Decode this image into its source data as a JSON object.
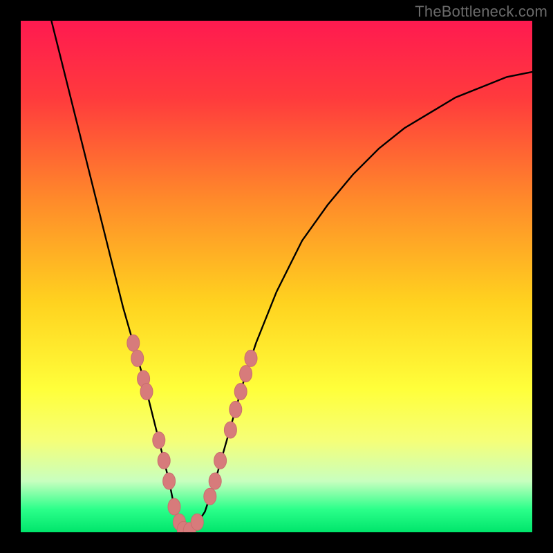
{
  "watermark": "TheBottleneck.com",
  "colors": {
    "frame": "#000000",
    "curve": "#000000",
    "marker_fill": "#d77b7b",
    "marker_stroke": "#c96e6e",
    "gradient_stops": [
      {
        "offset": 0.0,
        "color": "#ff1a50"
      },
      {
        "offset": 0.15,
        "color": "#ff3a3d"
      },
      {
        "offset": 0.35,
        "color": "#ff8a2a"
      },
      {
        "offset": 0.55,
        "color": "#ffd21f"
      },
      {
        "offset": 0.72,
        "color": "#ffff3a"
      },
      {
        "offset": 0.82,
        "color": "#f6ff77"
      },
      {
        "offset": 0.9,
        "color": "#c8ffbf"
      },
      {
        "offset": 0.955,
        "color": "#2bff8a"
      },
      {
        "offset": 1.0,
        "color": "#00e56b"
      }
    ]
  },
  "chart_data": {
    "type": "line",
    "title": "",
    "xlabel": "",
    "ylabel": "",
    "xlim": [
      0,
      100
    ],
    "ylim": [
      0,
      100
    ],
    "grid": false,
    "legend": false,
    "series": [
      {
        "name": "curve",
        "x": [
          6,
          8,
          10,
          12,
          14,
          16,
          18,
          20,
          22,
          24,
          26,
          27,
          28,
          29,
          30,
          31,
          32,
          33,
          34,
          36,
          38,
          40,
          42,
          44,
          46,
          50,
          55,
          60,
          65,
          70,
          75,
          80,
          85,
          90,
          95,
          100
        ],
        "y": [
          100,
          92,
          84,
          76,
          68,
          60,
          52,
          44,
          37,
          30,
          22,
          18,
          14,
          10,
          5,
          2,
          0,
          0,
          1,
          4,
          10,
          17,
          24,
          31,
          37,
          47,
          57,
          64,
          70,
          75,
          79,
          82,
          85,
          87,
          89,
          90
        ]
      }
    ],
    "markers": [
      {
        "x": 22.0,
        "y": 37.0
      },
      {
        "x": 22.8,
        "y": 34.0
      },
      {
        "x": 24.0,
        "y": 30.0
      },
      {
        "x": 24.6,
        "y": 27.5
      },
      {
        "x": 27.0,
        "y": 18.0
      },
      {
        "x": 28.0,
        "y": 14.0
      },
      {
        "x": 29.0,
        "y": 10.0
      },
      {
        "x": 30.0,
        "y": 5.0
      },
      {
        "x": 31.0,
        "y": 2.0
      },
      {
        "x": 31.8,
        "y": 0.5
      },
      {
        "x": 33.0,
        "y": 0.3
      },
      {
        "x": 34.5,
        "y": 2.0
      },
      {
        "x": 37.0,
        "y": 7.0
      },
      {
        "x": 38.0,
        "y": 10.0
      },
      {
        "x": 39.0,
        "y": 14.0
      },
      {
        "x": 41.0,
        "y": 20.0
      },
      {
        "x": 42.0,
        "y": 24.0
      },
      {
        "x": 43.0,
        "y": 27.5
      },
      {
        "x": 44.0,
        "y": 31.0
      },
      {
        "x": 45.0,
        "y": 34.0
      }
    ]
  }
}
